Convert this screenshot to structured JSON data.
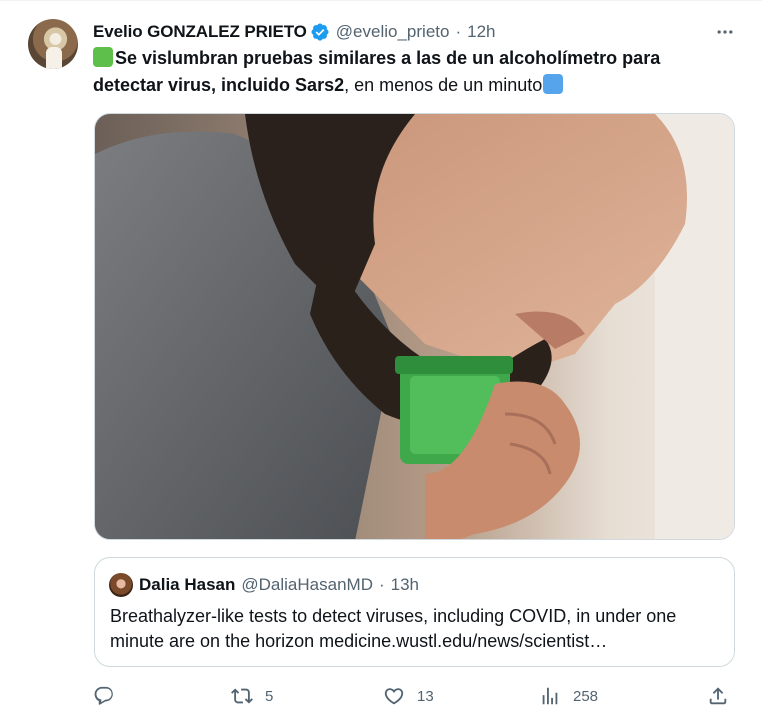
{
  "tweet": {
    "author_name": "Evelio GONZALEZ PRIETO",
    "author_handle": "@evelio_prieto",
    "separator": "·",
    "time": "12h",
    "text_bold": "Se vislumbran pruebas similares a las de un alcoholímetro para detectar virus, incluido Sars2",
    "text_rest": ", en menos de un minuto",
    "emoji_start": "green-square-emoji",
    "emoji_end": "blue-square-emoji",
    "media_alt": "Man breathing into a green breathalyzer device"
  },
  "quote": {
    "author_name": "Dalia Hasan",
    "author_handle": "@DaliaHasanMD",
    "separator": "·",
    "time": "13h",
    "text": "Breathalyzer-like tests to detect viruses, including COVID, in under one minute are on the horizon medicine.wustl.edu/news/scientist…"
  },
  "actions": {
    "reply_count": "",
    "retweet_count": "5",
    "like_count": "13",
    "views_count": "258"
  },
  "colors": {
    "verified": "#1d9bf0",
    "secondary_text": "#536471",
    "border": "#cfd9de"
  }
}
